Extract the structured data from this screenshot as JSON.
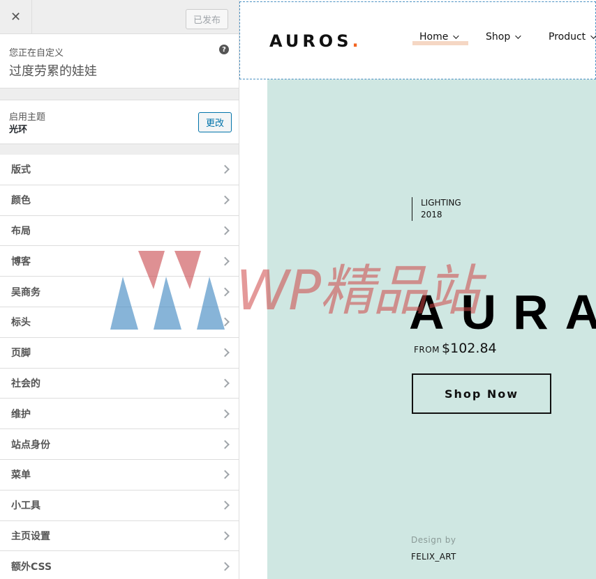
{
  "customizer": {
    "close_icon": "close-icon",
    "publish_label": "已发布",
    "info_label": "您正在自定义",
    "site_title": "过度劳累的娃娃",
    "help_icon": "help-icon",
    "theme_label": "启用主题",
    "theme_name": "光环",
    "change_label": "更改",
    "panels": [
      "版式",
      "颜色",
      "布局",
      "博客",
      "吴商务",
      "标头",
      "页脚",
      "社会的",
      "维护",
      "站点身份",
      "菜单",
      "小工具",
      "主页设置",
      "额外CSS"
    ]
  },
  "preview": {
    "logo": "AUROS",
    "logo_dot": ".",
    "nav": [
      "Home",
      "Shop",
      "Product"
    ],
    "hero": {
      "tag_line1": "LIGHTING",
      "tag_line2": "2018",
      "heading": "AURA",
      "price_prefix": "FROM",
      "price": "$102.84",
      "button": "Shop Now",
      "design_by": "Design by",
      "designer": "FELIX_ART"
    },
    "colors": {
      "hero_bg": "#cfe7e2",
      "logo_accent": "#f26522",
      "nav_underline": "#f5d7c4"
    }
  },
  "watermark": {
    "text": "WP精品站"
  }
}
